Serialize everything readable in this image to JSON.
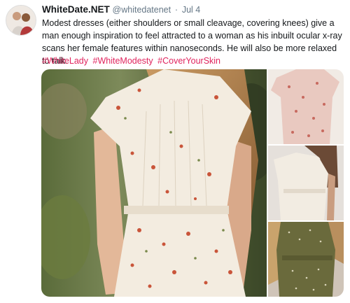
{
  "tweet": {
    "author_name": "WhiteDate.NET",
    "handle": "@whitedatenet",
    "separator": "·",
    "date": "Jul 4",
    "text": "Modest dresses (either shoulders or small cleavage, covering knees) give a man enough inspiration to feel attracted to a woman as his inbuilt ocular x-ray scans her female features within nanoseconds. He will also be more relaxed to talk.",
    "hashtags": [
      "#WhiteLady",
      "#WhiteModesty",
      "#CoverYourSkin"
    ]
  },
  "colors": {
    "hashtag": "#e0245e",
    "meta_text": "#657786",
    "body_text": "#14171a"
  },
  "icons": {
    "avatar": "profile-photo"
  }
}
